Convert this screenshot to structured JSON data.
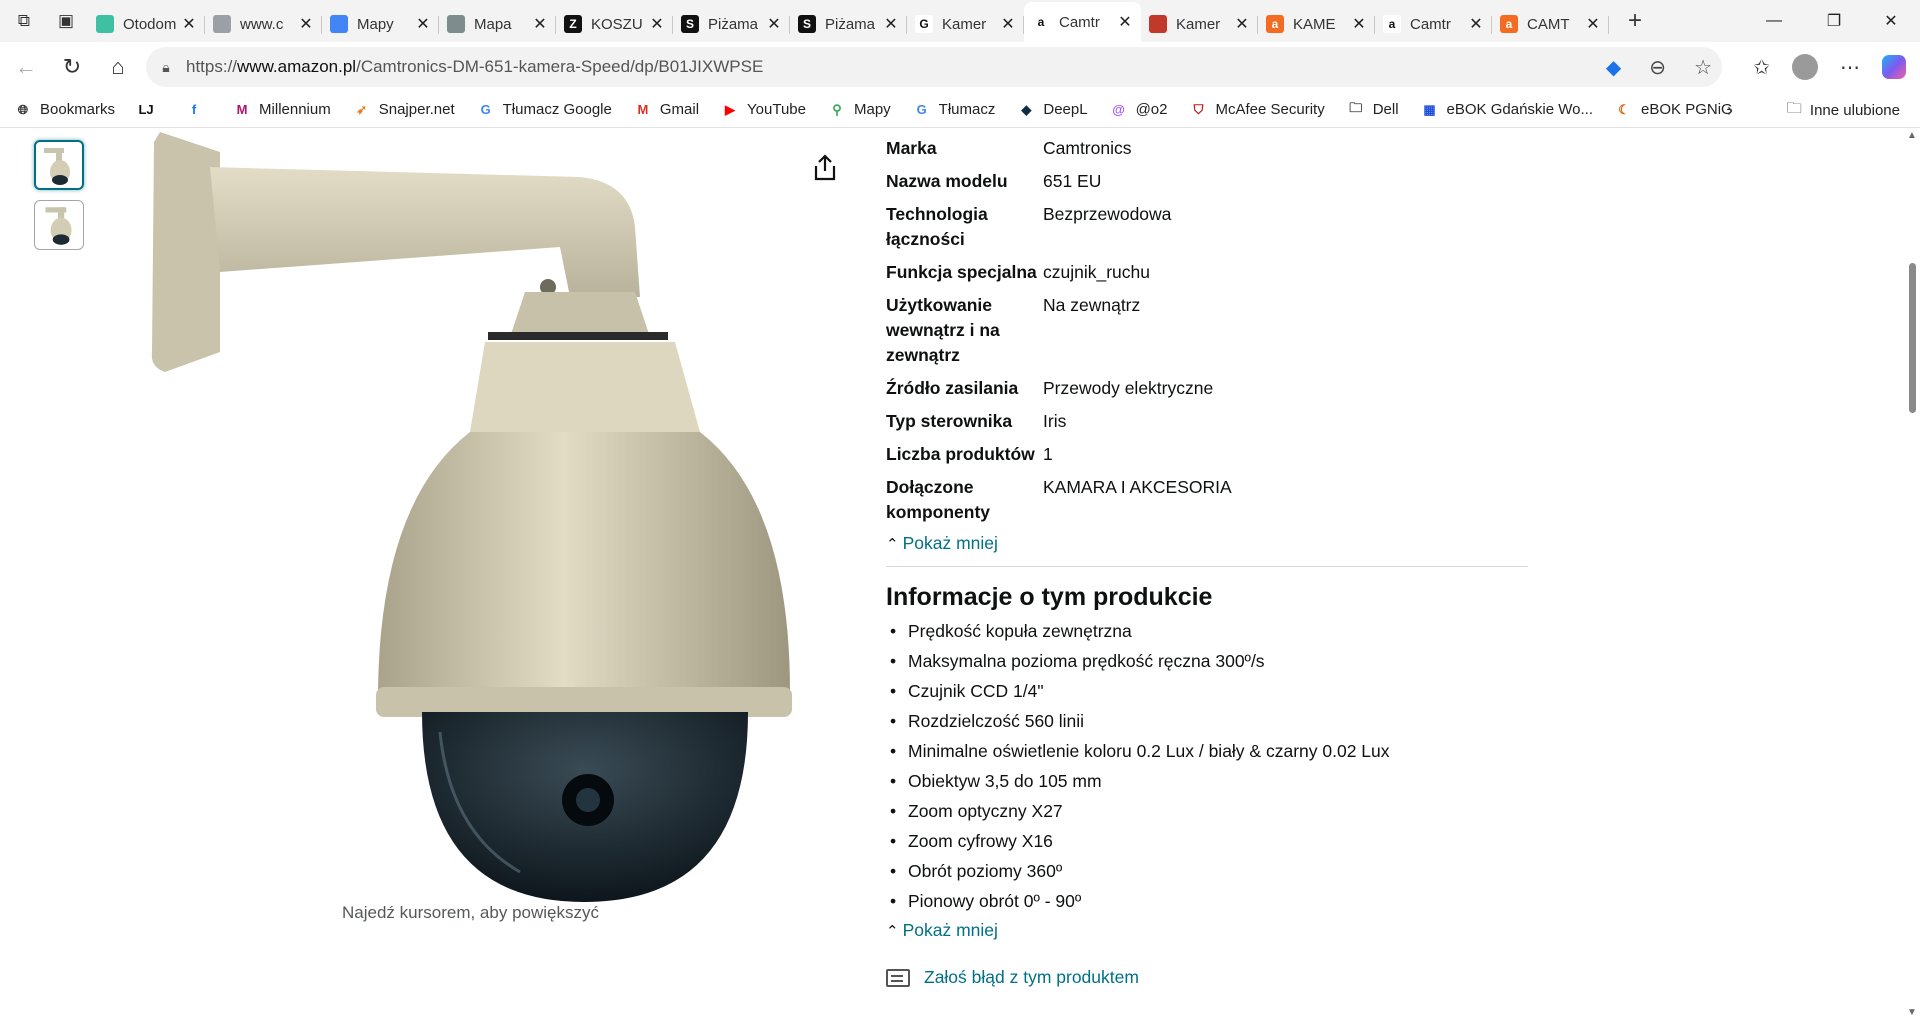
{
  "browser": {
    "tabs": [
      {
        "title": "Otodom",
        "favicon_color": "#3ec1a3",
        "favicon_glyph": ""
      },
      {
        "title": "www.c",
        "favicon_color": "#9aa0a6",
        "favicon_glyph": ""
      },
      {
        "title": "Mapy",
        "favicon_color": "#4285f4",
        "favicon_glyph": ""
      },
      {
        "title": "Mapa",
        "favicon_color": "#7f8c8d",
        "favicon_glyph": ""
      },
      {
        "title": "KOSZU",
        "favicon_color": "#111111",
        "favicon_glyph": "Z"
      },
      {
        "title": "Piżama",
        "favicon_color": "#111111",
        "favicon_glyph": "S"
      },
      {
        "title": "Piżama",
        "favicon_color": "#111111",
        "favicon_glyph": "S"
      },
      {
        "title": "Kamer",
        "favicon_color": "#ffffff",
        "favicon_glyph": "G"
      },
      {
        "title": "Camtr",
        "favicon_color": "#ffffff",
        "favicon_glyph": "a",
        "active": true
      },
      {
        "title": "Kamer",
        "favicon_color": "#c0392b",
        "favicon_glyph": ""
      },
      {
        "title": "KAME",
        "favicon_color": "#f36c21",
        "favicon_glyph": "a"
      },
      {
        "title": "Camtr",
        "favicon_color": "#ffffff",
        "favicon_glyph": "a"
      },
      {
        "title": "CAMT",
        "favicon_color": "#f36c21",
        "favicon_glyph": "a"
      }
    ],
    "url_prefix": "https://",
    "url_host": "www.amazon.pl",
    "url_path": "/Camtronics-DM-651-kamera-Speed/dp/B01JIXWPSE",
    "bookmarks": [
      {
        "label": "Bookmarks",
        "icon": "globe-icon"
      },
      {
        "label": "",
        "icon": "lj-icon"
      },
      {
        "label": "",
        "icon": "facebook-icon"
      },
      {
        "label": "Millennium",
        "icon": "millennium-icon"
      },
      {
        "label": "Snajper.net",
        "icon": "snajper-icon"
      },
      {
        "label": "Tłumacz Google",
        "icon": "translate-icon"
      },
      {
        "label": "Gmail",
        "icon": "gmail-icon"
      },
      {
        "label": "YouTube",
        "icon": "youtube-icon"
      },
      {
        "label": "Mapy",
        "icon": "maps-icon"
      },
      {
        "label": "Tłumacz",
        "icon": "translate-icon"
      },
      {
        "label": "DeepL",
        "icon": "deepl-icon"
      },
      {
        "label": "@o2",
        "icon": "o2-icon"
      },
      {
        "label": "McAfee Security",
        "icon": "mcafee-icon"
      },
      {
        "label": "Dell",
        "icon": "folder-icon"
      },
      {
        "label": "eBOK Gdańskie Wo...",
        "icon": "ebok-icon"
      },
      {
        "label": "eBOK PGNiG",
        "icon": "pgnig-icon"
      }
    ],
    "other_favorites": "Inne ulubione"
  },
  "product": {
    "zoom_hint": "Najedź kursorem, aby powiększyć",
    "specs": [
      {
        "key": "Marka",
        "value": "Camtronics"
      },
      {
        "key": "Nazwa modelu",
        "value": "651 EU"
      },
      {
        "key": "Technologia łączności",
        "value": "Bezprzewodowa"
      },
      {
        "key": "Funkcja specjalna",
        "value": "czujnik_ruchu"
      },
      {
        "key": "Użytkowanie wewnątrz i na zewnątrz",
        "value": "Na zewnątrz"
      },
      {
        "key": "Źródło zasilania",
        "value": "Przewody elektryczne"
      },
      {
        "key": "Typ sterownika",
        "value": "Iris"
      },
      {
        "key": "Liczba produktów",
        "value": "1"
      },
      {
        "key": "Dołączone komponenty",
        "value": "KAMARA I AKCESORIA"
      }
    ],
    "show_less": "Pokaż mniej",
    "about_title": "Informacje o tym produkcie",
    "about_bullets": [
      "Prędkość kopuła zewnętrzna",
      "Maksymalna pozioma prędkość ręczna 300º/s",
      "Czujnik CCD 1/4\"",
      "Rozdzielczość 560 linii",
      "Minimalne oświetlenie koloru 0.2 Lux / biały & czarny 0.02 Lux",
      "Obiektyw 3,5 do 105 mm",
      "Zoom optyczny X27",
      "Zoom cyfrowy X16",
      "Obrót poziomy 360º",
      "Pionowy obrót 0º - 90º"
    ],
    "show_less_2": "Pokaż mniej",
    "report_link": "Załoś błąd z tym produktem"
  },
  "colors": {
    "link": "#007185",
    "text": "#0f1111",
    "muted": "#565959"
  }
}
